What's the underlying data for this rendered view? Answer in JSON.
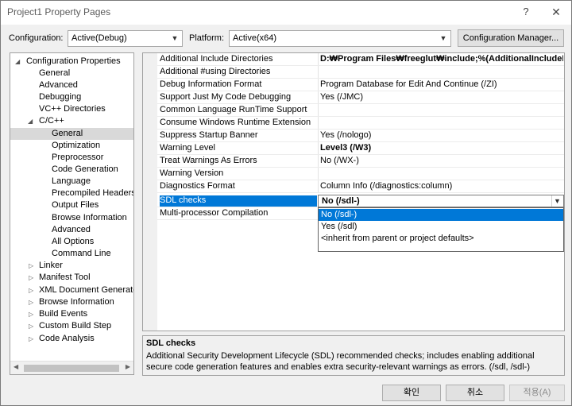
{
  "window": {
    "title": "Project1 Property Pages",
    "help": "?",
    "close": "✕"
  },
  "header": {
    "configuration_label": "Configuration:",
    "configuration_value": "Active(Debug)",
    "platform_label": "Platform:",
    "platform_value": "Active(x64)",
    "config_manager_button": "Configuration Manager..."
  },
  "tree": {
    "items": [
      {
        "label": "Configuration Properties"
      },
      {
        "label": "General"
      },
      {
        "label": "Advanced"
      },
      {
        "label": "Debugging"
      },
      {
        "label": "VC++ Directories"
      },
      {
        "label": "C/C++"
      },
      {
        "label": "General"
      },
      {
        "label": "Optimization"
      },
      {
        "label": "Preprocessor"
      },
      {
        "label": "Code Generation"
      },
      {
        "label": "Language"
      },
      {
        "label": "Precompiled Headers"
      },
      {
        "label": "Output Files"
      },
      {
        "label": "Browse Information"
      },
      {
        "label": "Advanced"
      },
      {
        "label": "All Options"
      },
      {
        "label": "Command Line"
      },
      {
        "label": "Linker"
      },
      {
        "label": "Manifest Tool"
      },
      {
        "label": "XML Document Generator"
      },
      {
        "label": "Browse Information"
      },
      {
        "label": "Build Events"
      },
      {
        "label": "Custom Build Step"
      },
      {
        "label": "Code Analysis"
      }
    ]
  },
  "grid": {
    "rows": [
      {
        "key": "Additional Include Directories",
        "value": "D:₩Program Files₩freeglut₩include;%(AdditionalIncludeDirectories)"
      },
      {
        "key": "Additional #using Directories",
        "value": ""
      },
      {
        "key": "Debug Information Format",
        "value": "Program Database for Edit And Continue (/ZI)"
      },
      {
        "key": "Support Just My Code Debugging",
        "value": "Yes (/JMC)"
      },
      {
        "key": "Common Language RunTime Support",
        "value": ""
      },
      {
        "key": "Consume Windows Runtime Extension",
        "value": ""
      },
      {
        "key": "Suppress Startup Banner",
        "value": "Yes (/nologo)"
      },
      {
        "key": "Warning Level",
        "value": "Level3 (/W3)"
      },
      {
        "key": "Treat Warnings As Errors",
        "value": "No (/WX-)"
      },
      {
        "key": "Warning Version",
        "value": ""
      },
      {
        "key": "Diagnostics Format",
        "value": "Column Info (/diagnostics:column)"
      },
      {
        "key": "SDL checks",
        "value": "No (/sdl-)"
      },
      {
        "key": "Multi-processor Compilation",
        "value": ""
      }
    ]
  },
  "dropdown": {
    "options": [
      "No (/sdl-)",
      "Yes (/sdl)",
      "<inherit from parent or project defaults>"
    ]
  },
  "description": {
    "title": "SDL checks",
    "text": "Additional Security Development Lifecycle (SDL) recommended checks; includes enabling additional secure code generation features and enables extra security-relevant warnings as errors.     (/sdl, /sdl-)"
  },
  "footer": {
    "ok": "확인",
    "cancel": "취소",
    "apply": "적용(A)"
  },
  "colors": {
    "selection": "#0078d7",
    "tree_selection": "#d9d9d9",
    "disabled_text": "#8c8c8c"
  }
}
